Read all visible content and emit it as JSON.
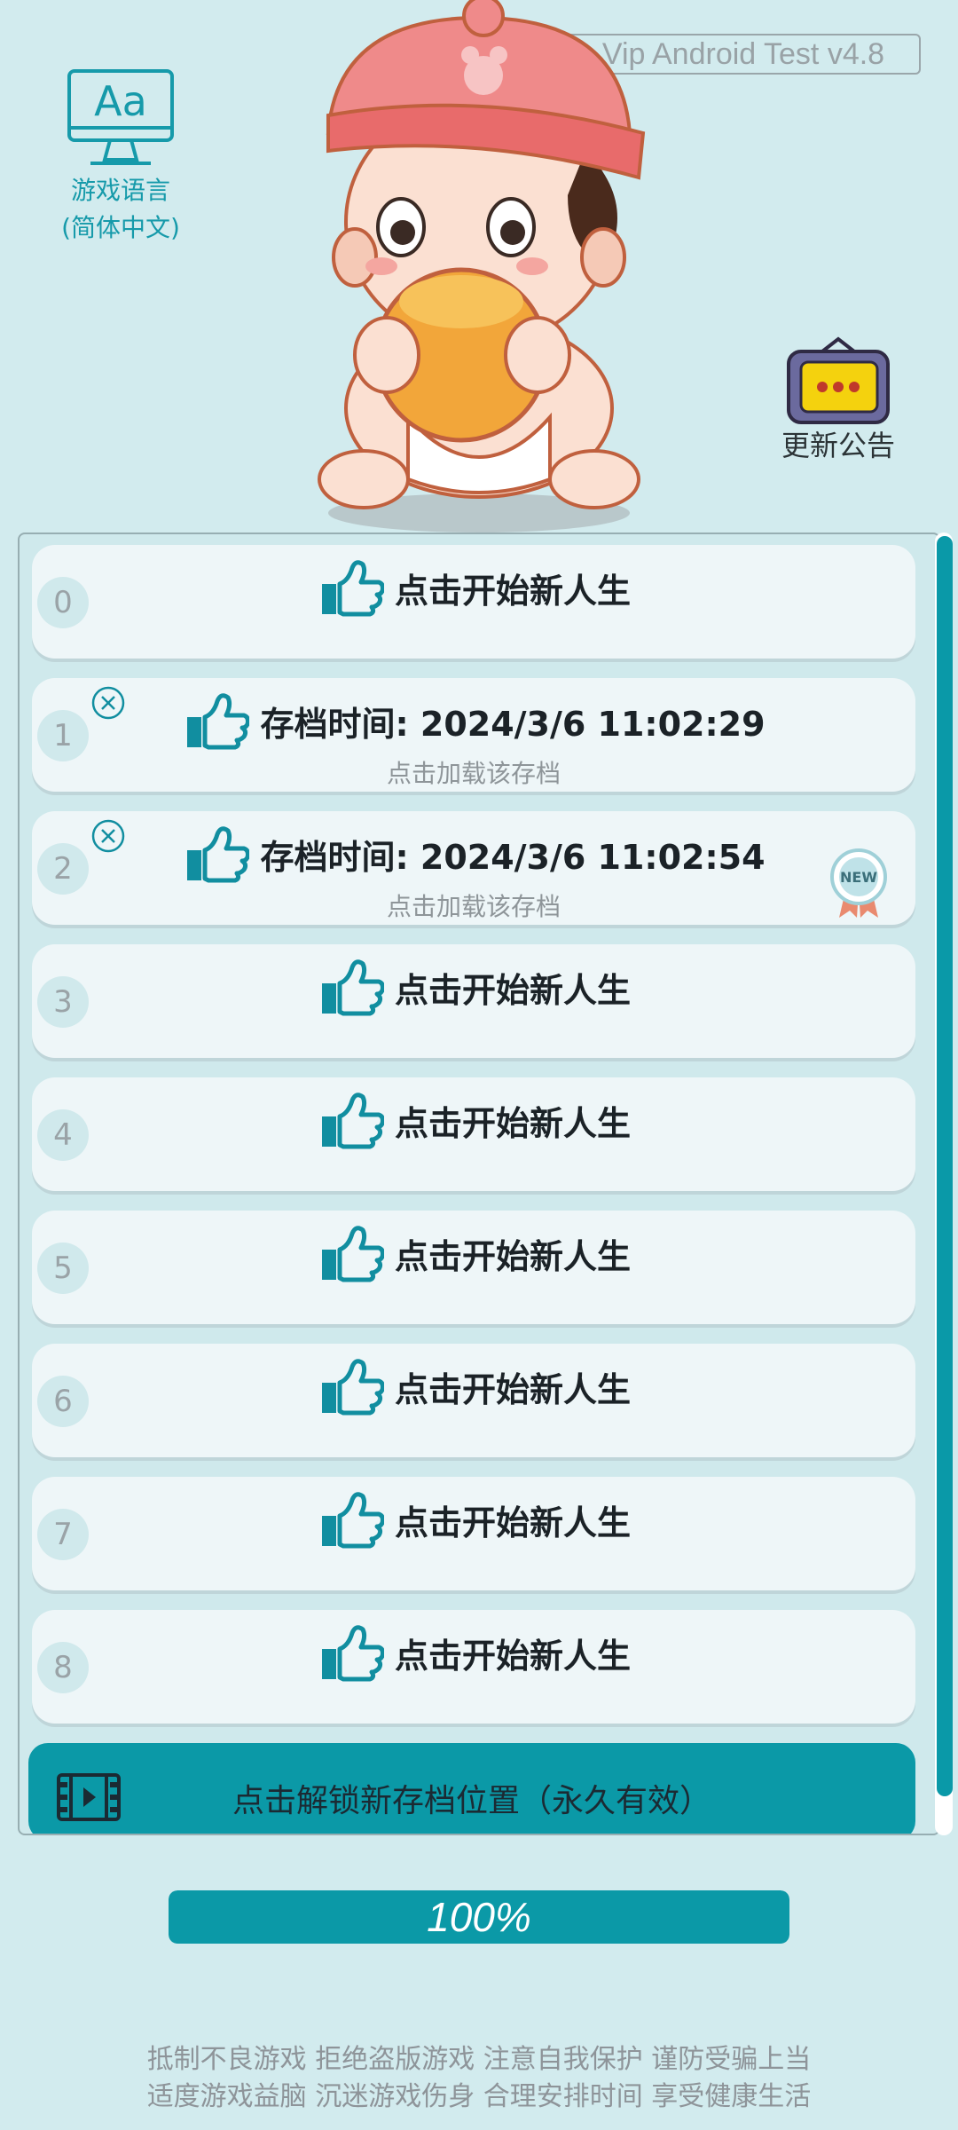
{
  "version": "Vip Android Test v4.8",
  "language": {
    "line1": "游戏语言",
    "line2": "(简体中文)",
    "icon": "Aa"
  },
  "notice": {
    "label": "更新公告"
  },
  "slots": [
    {
      "num": "0",
      "type": "new",
      "title": "点击开始新人生"
    },
    {
      "num": "1",
      "type": "save",
      "title": "存档时间: 2024/3/6 11:02:29",
      "sub": "点击加载该存档"
    },
    {
      "num": "2",
      "type": "save",
      "title": "存档时间: 2024/3/6 11:02:54",
      "sub": "点击加载该存档",
      "badge": "NEW"
    },
    {
      "num": "3",
      "type": "new",
      "title": "点击开始新人生"
    },
    {
      "num": "4",
      "type": "new",
      "title": "点击开始新人生"
    },
    {
      "num": "5",
      "type": "new",
      "title": "点击开始新人生"
    },
    {
      "num": "6",
      "type": "new",
      "title": "点击开始新人生"
    },
    {
      "num": "7",
      "type": "new",
      "title": "点击开始新人生"
    },
    {
      "num": "8",
      "type": "new",
      "title": "点击开始新人生"
    }
  ],
  "unlock": {
    "label": "点击解锁新存档位置（永久有效）"
  },
  "progress": {
    "value": 100,
    "label": "100%"
  },
  "footer": {
    "line1": "抵制不良游戏 拒绝盗版游戏 注意自我保护 谨防受骗上当",
    "line2": "适度游戏益脑 沉迷游戏伤身 合理安排时间 享受健康生活"
  },
  "colors": {
    "accent": "#0b99a7",
    "background": "#d2ebee"
  }
}
